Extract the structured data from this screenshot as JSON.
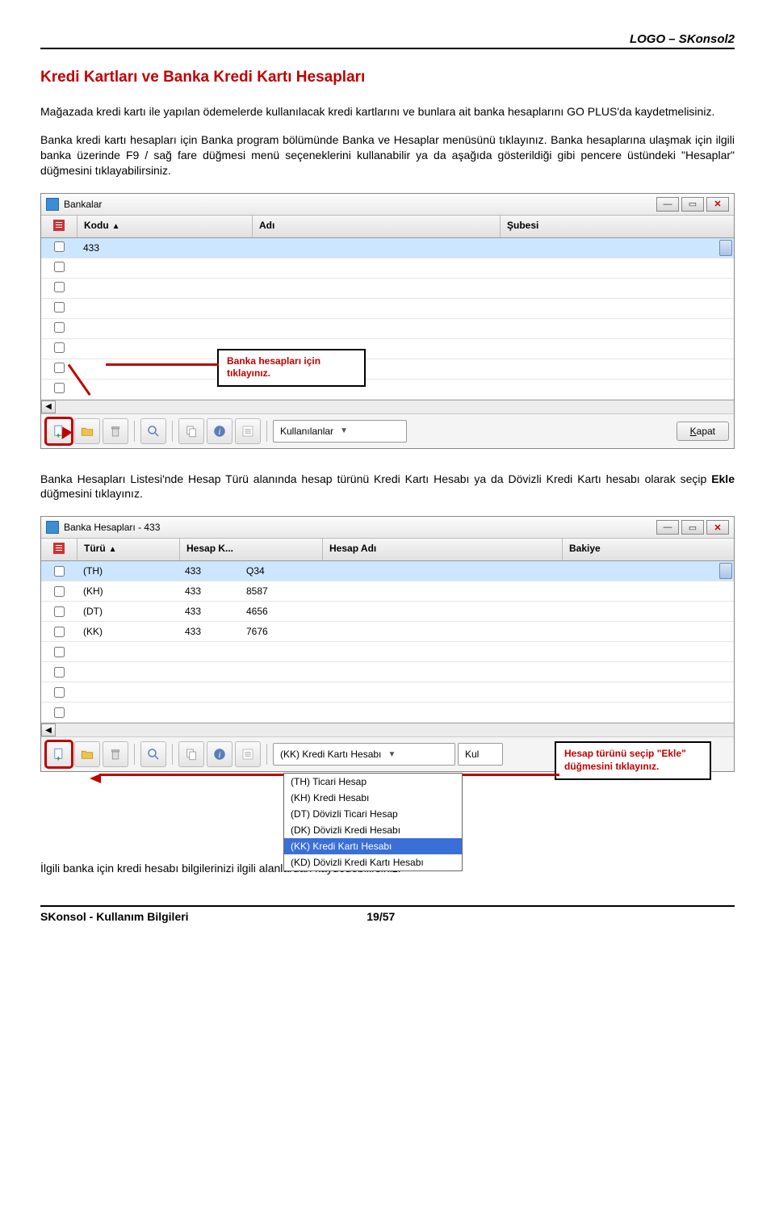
{
  "header": {
    "brand": "LOGO – SKonsol2"
  },
  "heading": "Kredi Kartları ve Banka Kredi Kartı Hesapları",
  "p1": "Mağazada kredi kartı ile yapılan ödemelerde kullanılacak kredi kartlarını ve bunlara ait banka hesaplarını GO PLUS'da kaydetmelisiniz.",
  "p2": "Banka kredi kartı hesapları için Banka program bölümünde Banka ve Hesaplar menüsünü tıklayınız. Banka hesaplarına ulaşmak için ilgili banka üzerinde F9 / sağ fare düğmesi menü seçeneklerini kullanabilir ya da aşağıda gösterildiği gibi pencere üstündeki \"Hesaplar\" düğmesini tıklayabilirsiniz.",
  "window1": {
    "title": "Bankalar",
    "cols": {
      "kodu": "Kodu",
      "adi": "Adı",
      "subesi": "Şubesi"
    },
    "row1": {
      "kodu": "433"
    },
    "select": "Kullanılanlar",
    "close": {
      "pre": "",
      "u": "K",
      "post": "apat"
    },
    "callout": "Banka hesapları için tıklayınız."
  },
  "p3_pre": "Banka Hesapları Listesi'nde Hesap Türü alanında hesap türünü Kredi Kartı Hesabı ya da Dövizli Kredi Kartı hesabı olarak seçip ",
  "p3_bold": "Ekle",
  "p3_post": " düğmesini tıklayınız.",
  "window2": {
    "title": "Banka Hesapları - 433",
    "cols": {
      "turu": "Türü",
      "hkodu": "Hesap K...",
      "hadi": "Hesap Adı",
      "bakiye": "Bakiye"
    },
    "rows": [
      {
        "turu": "(TH)",
        "k1": "433",
        "k2": "Q34"
      },
      {
        "turu": "(KH)",
        "k1": "433",
        "k2": "8587"
      },
      {
        "turu": "(DT)",
        "k1": "433",
        "k2": "4656"
      },
      {
        "turu": "(KK)",
        "k1": "433",
        "k2": "7676"
      }
    ],
    "dropdown_value": "(KK) Kredi Kartı Hesabı",
    "dropdown": [
      "(TH) Ticari Hesap",
      "(KH) Kredi Hesabı",
      "(DT) Dövizli Ticari Hesap",
      "(DK) Dövizli Kredi Hesabı",
      "(KK) Kredi Kartı Hesabı",
      "(KD) Dövizli Kredi Kartı Hesabı"
    ],
    "right_button": "Kul",
    "callout": "Hesap türünü seçip \"Ekle\" düğmesini tıklayınız."
  },
  "p4": "İlgili banka için kredi hesabı bilgilerinizi ilgili alanlardan kaydedebilirsiniz.",
  "footer": {
    "left": "SKonsol - Kullanım Bilgileri",
    "page": "19/57"
  }
}
